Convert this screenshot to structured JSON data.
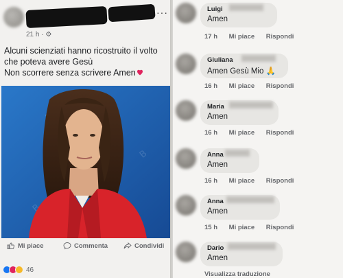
{
  "post": {
    "time": "21 h · ⚙",
    "more": "···",
    "text_line1": "Alcuni scienziati hanno ricostruito il volto",
    "text_line2": "che poteva avere Gesù",
    "text_line3": "Non scorrere senza scrivere Amen",
    "actions": {
      "like": "Mi piace",
      "comment": "Commenta",
      "share": "Condividi"
    },
    "reaction_count": "46"
  },
  "comments": [
    {
      "name": "Luigi",
      "text": "Amen",
      "time": "17 h",
      "like": "Mi piace",
      "reply": "Rispondi"
    },
    {
      "name": "Giuliana",
      "text": "Amen Gesù Mio 🙏",
      "time": "16 h",
      "like": "Mi piace",
      "reply": "Rispondi"
    },
    {
      "name": "Maria",
      "text": "Amen",
      "time": "16 h",
      "like": "Mi piace",
      "reply": "Rispondi"
    },
    {
      "name": "Anna",
      "text": "Amen",
      "time": "16 h",
      "like": "Mi piace",
      "reply": "Rispondi"
    },
    {
      "name": "Anna",
      "text": "Amen",
      "time": "15 h",
      "like": "Mi piace",
      "reply": "Rispondi"
    },
    {
      "name": "Dario",
      "text": "Amen",
      "translate": "Visualizza traduzione"
    }
  ],
  "colors": {
    "like_blue": "#1877f2",
    "heart_red": "#e0245e",
    "photo_bg": "#1f5fb1",
    "shirt_red": "#d8232a"
  }
}
